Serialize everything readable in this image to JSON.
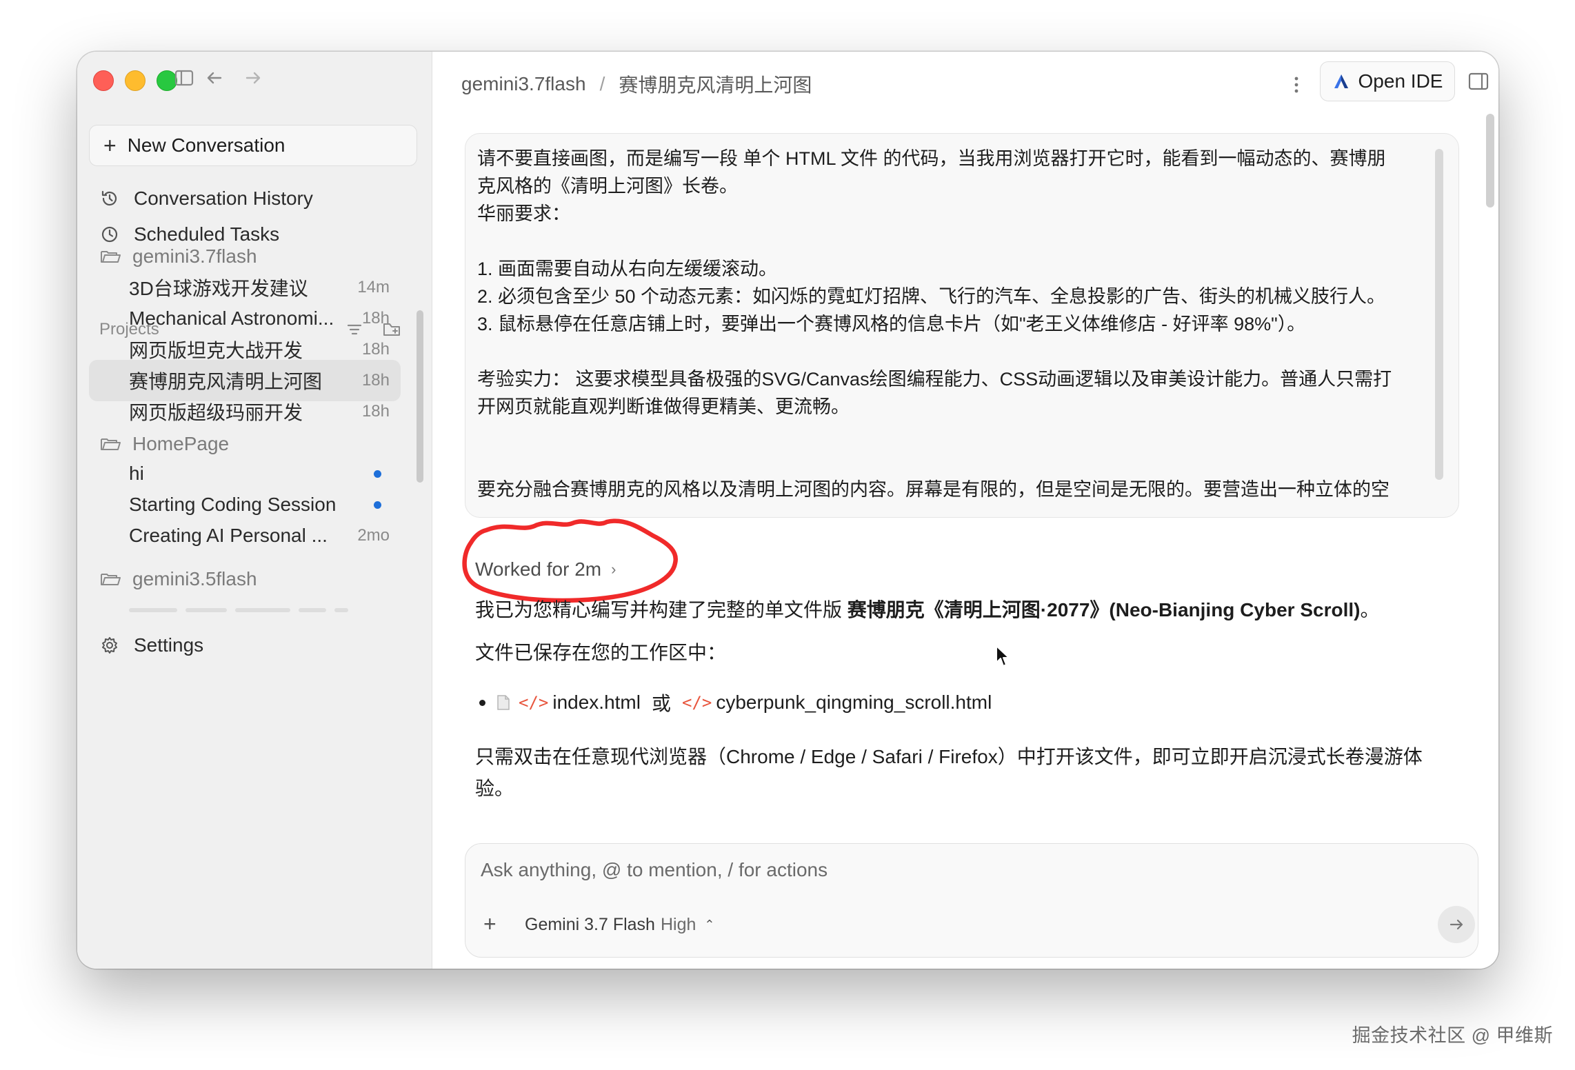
{
  "window": {
    "toolbar_icons": [
      "sidebar-toggle-icon",
      "arrow-left-icon",
      "arrow-right-icon"
    ]
  },
  "sidebar": {
    "new_conversation": "New Conversation",
    "nav": [
      {
        "label": "Conversation History",
        "icon": "history-icon"
      },
      {
        "label": "Scheduled Tasks",
        "icon": "clock-icon"
      }
    ],
    "projects_label": "Projects",
    "projects": [
      {
        "name": "gemini3.7flash",
        "conversations": [
          {
            "title": "3D台球游戏开发建议",
            "time": "14m"
          },
          {
            "title": "Mechanical Astronomi...",
            "time": "18h"
          },
          {
            "title": "网页版坦克大战开发",
            "time": "18h"
          },
          {
            "title": "赛博朋克风清明上河图",
            "time": "18h",
            "active": true
          },
          {
            "title": "网页版超级玛丽开发",
            "time": "18h"
          }
        ]
      },
      {
        "name": "HomePage",
        "conversations": [
          {
            "title": "hi",
            "unread": true
          },
          {
            "title": "Starting Coding Session",
            "unread": true
          },
          {
            "title": "Creating AI Personal ...",
            "time": "2mo"
          }
        ]
      },
      {
        "name": "gemini3.5flash",
        "conversations": []
      }
    ],
    "settings_label": "Settings"
  },
  "header": {
    "project": "gemini3.7flash",
    "separator": "/",
    "conversation": "赛博朋克风清明上河图",
    "open_ide_label": "Open IDE"
  },
  "prompt": {
    "text": "请不要直接画图，而是编写一段 单个 HTML 文件 的代码，当我用浏览器打开它时，能看到一幅动态的、赛博朋\n克风格的《清明上河图》长卷。\n华丽要求：\n\n1. 画面需要自动从右向左缓缓滚动。\n2. 必须包含至少 50 个动态元素：如闪烁的霓虹灯招牌、飞行的汽车、全息投影的广告、街头的机械义肢行人。\n3. 鼠标悬停在任意店铺上时，要弹出一个赛博风格的信息卡片（如\"老王义体维修店 - 好评率 98%\"）。\n\n考验实力： 这要求模型具备极强的SVG/Canvas绘图编程能力、CSS动画逻辑以及审美设计能力。普通人只需打\n开网页就能直观判断谁做得更精美、更流畅。\n\n\n要充分融合赛博朋克的风格以及清明上河图的内容。屏幕是有限的，但是空间是无限的。要营造出一种立体的空"
  },
  "response": {
    "worked_label": "Worked for 2m",
    "line1_prefix": "我已为您精心编写并构建了完整的单文件版 ",
    "line1_bold": "赛博朋克《清明上河图·2077》(Neo-Bianjing Cyber Scroll)",
    "line1_suffix": "。",
    "line2": "文件已保存在您的工作区中：",
    "file1": "index.html",
    "or_word": "或",
    "file2": "cyberpunk_qingming_scroll.html",
    "code_glyph": "</>",
    "paragraph": "只需双击在任意现代浏览器（Chrome / Edge / Safari / Firefox）中打开该文件，即可立即开启沉浸式长卷漫游体验。"
  },
  "composer": {
    "placeholder": "Ask anything, @ to mention, / for actions",
    "model": "Gemini 3.7 Flash",
    "level": "High"
  },
  "watermark": "掘金技术社区 @ 甲维斯"
}
